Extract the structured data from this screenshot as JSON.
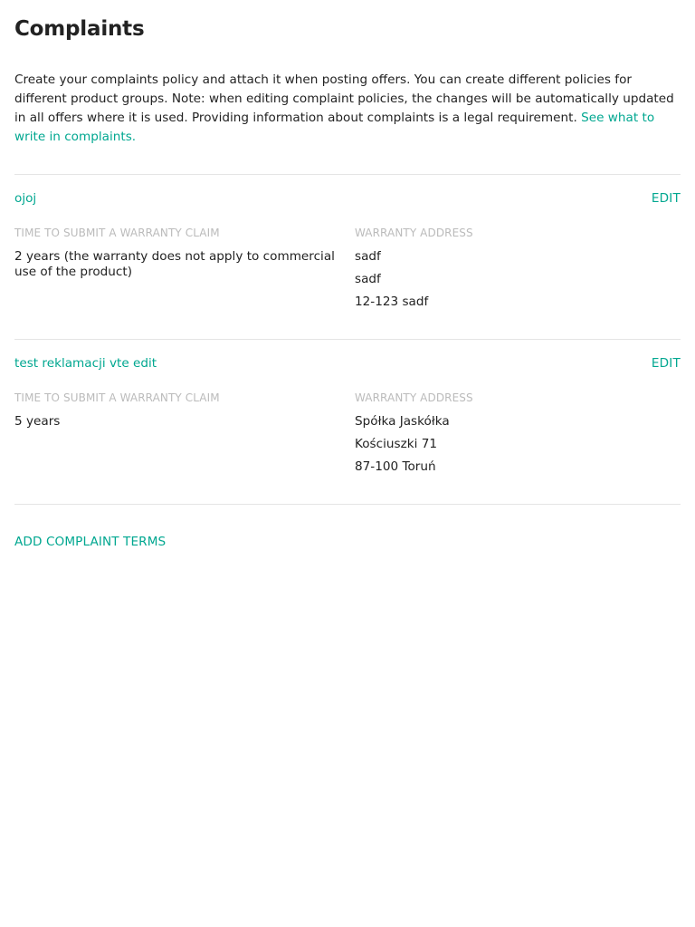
{
  "page": {
    "title": "Complaints",
    "intro_text": "Create your complaints policy and attach it when posting offers. You can create different policies for different product groups. Note: when editing complaint policies, the changes will be automatically updated in all offers where it is used. Providing information about complaints is a legal requirement. ",
    "intro_link": "See what to write in complaints."
  },
  "policies": [
    {
      "name": "ojoj",
      "edit_label": "EDIT",
      "time_label": "TIME TO SUBMIT A WARRANTY CLAIM",
      "time_value": "2 years (the warranty does not apply to commercial use of the product)",
      "address_label": "WARRANTY ADDRESS",
      "address_lines": [
        "sadf",
        "sadf",
        "12-123 sadf"
      ]
    },
    {
      "name": "test reklamacji vte edit",
      "edit_label": "EDIT",
      "time_label": "TIME TO SUBMIT A WARRANTY CLAIM",
      "time_value": "5 years",
      "address_label": "WARRANTY ADDRESS",
      "address_lines": [
        "Spółka Jaskółka",
        "Kościuszki 71",
        "87-100 Toruń"
      ]
    }
  ],
  "actions": {
    "add_terms_label": "ADD COMPLAINT TERMS"
  },
  "colors": {
    "accent": "#00a790",
    "text": "#222222",
    "label": "#bbbbbb",
    "divider": "#e5e5e5"
  }
}
